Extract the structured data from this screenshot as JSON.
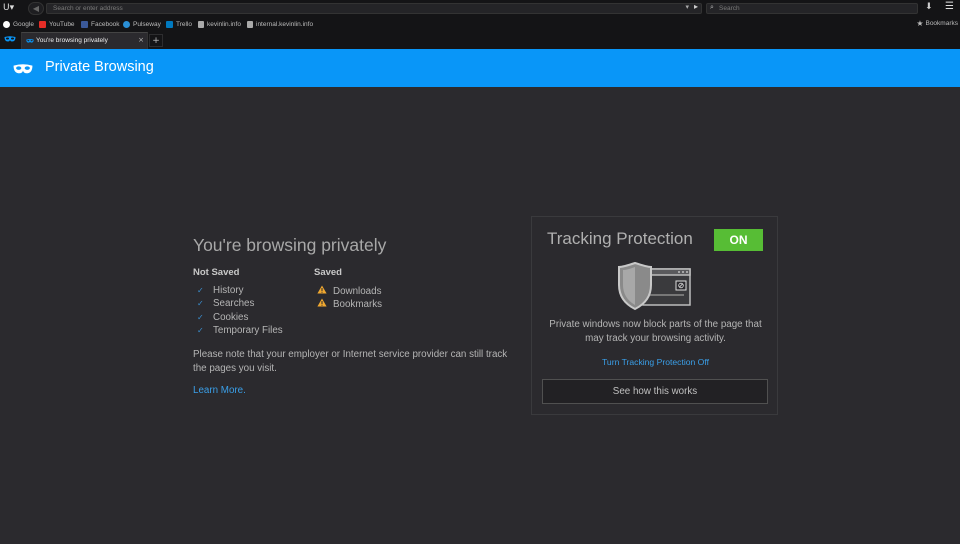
{
  "toolbar": {
    "url_placeholder": "Search or enter address",
    "search_placeholder": "Search",
    "back_glyph": "◀",
    "menu_glyph": "☰",
    "download_glyph": "⬇",
    "dropdown_glyph": "▾",
    "go_glyph": "▸",
    "search_glyph": "🔍",
    "app_menu_glyph": "ᑌ▾"
  },
  "bookmarks": {
    "items": [
      {
        "label": "Google",
        "icon": "google-icon",
        "color": "#ffffff"
      },
      {
        "label": "YouTube",
        "icon": "youtube-icon",
        "color": "#e52d27"
      },
      {
        "label": "Facebook",
        "icon": "facebook-icon",
        "color": "#3b5998"
      },
      {
        "label": "Pulseway",
        "icon": "pulseway-icon",
        "color": "#2a8fd6"
      },
      {
        "label": "Trello",
        "icon": "trello-icon",
        "color": "#0079bf"
      },
      {
        "label": "kevinlin.info",
        "icon": "page-icon",
        "color": "#aaaaaa"
      },
      {
        "label": "internal.kevinlin.info",
        "icon": "page-icon",
        "color": "#aaaaaa"
      }
    ],
    "right_label": "Bookmarks",
    "star_glyph": "★"
  },
  "tabs": {
    "active_title": "You're browsing privately",
    "close_glyph": "×",
    "new_tab_glyph": "+"
  },
  "header": {
    "title": "Private Browsing"
  },
  "main": {
    "title": "You're browsing privately",
    "not_saved_heading": "Not Saved",
    "not_saved_items": [
      "History",
      "Searches",
      "Cookies",
      "Temporary Files"
    ],
    "saved_heading": "Saved",
    "saved_items": [
      "Downloads",
      "Bookmarks"
    ],
    "check_glyph": "✓",
    "note": "Please note that your employer or Internet service provider can still track the pages you visit.",
    "learn_more": "Learn More."
  },
  "tracking": {
    "title": "Tracking Protection",
    "status": "ON",
    "description": "Private windows now block parts of the page that may track your browsing activity.",
    "turn_off_link": "Turn Tracking Protection Off",
    "button_label": "See how this works"
  },
  "colors": {
    "header_bg": "#0996f8",
    "on_badge": "#57bd35",
    "link": "#3a9fe8",
    "warning": "#f0a830"
  }
}
